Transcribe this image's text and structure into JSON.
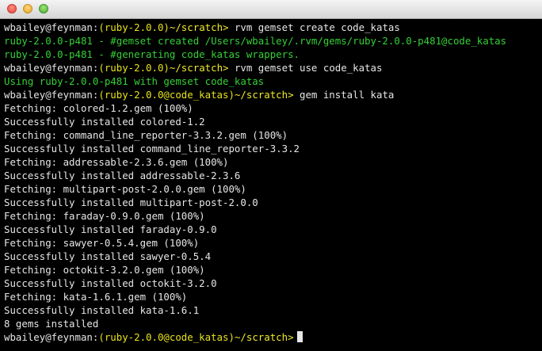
{
  "window": {
    "controls": [
      {
        "name": "close",
        "color": "#e0443a"
      },
      {
        "name": "minimize",
        "color": "#e0a32a"
      },
      {
        "name": "zoom",
        "color": "#4fae32"
      }
    ]
  },
  "colors": {
    "background": "#000000",
    "text": "#e6e6e6",
    "prompt_yellow": "#e8e21a",
    "success_green": "#35d135"
  },
  "terminal": {
    "prompt1": {
      "user": "wbailey@feynman:",
      "gemset": "(ruby-2.0.0)",
      "path": "~/scratch>",
      "command": " rvm gemset create code_katas"
    },
    "out1": "ruby-2.0.0-p481 - #gemset created /Users/wbailey/.rvm/gems/ruby-2.0.0-p481@code_katas",
    "out2": "ruby-2.0.0-p481 - #generating code_katas wrappers.",
    "prompt2": {
      "user": "wbailey@feynman:",
      "gemset": "(ruby-2.0.0)",
      "path": "~/scratch>",
      "command": " rvm gemset use code_katas"
    },
    "out3": "Using ruby-2.0.0-p481 with gemset code_katas",
    "prompt3": {
      "user": "wbailey@feynman:",
      "gemset": "(ruby-2.0.0@code_katas)",
      "path": "~/scratch>",
      "command": " gem install kata"
    },
    "output": [
      "Fetching: colored-1.2.gem (100%)",
      "Successfully installed colored-1.2",
      "Fetching: command_line_reporter-3.3.2.gem (100%)",
      "Successfully installed command_line_reporter-3.3.2",
      "Fetching: addressable-2.3.6.gem (100%)",
      "Successfully installed addressable-2.3.6",
      "Fetching: multipart-post-2.0.0.gem (100%)",
      "Successfully installed multipart-post-2.0.0",
      "Fetching: faraday-0.9.0.gem (100%)",
      "Successfully installed faraday-0.9.0",
      "Fetching: sawyer-0.5.4.gem (100%)",
      "Successfully installed sawyer-0.5.4",
      "Fetching: octokit-3.2.0.gem (100%)",
      "Successfully installed octokit-3.2.0",
      "Fetching: kata-1.6.1.gem (100%)",
      "Successfully installed kata-1.6.1",
      "8 gems installed"
    ],
    "prompt4": {
      "user": "wbailey@feynman:",
      "gemset": "(ruby-2.0.0@code_katas)",
      "path": "~/scratch>",
      "command": ""
    }
  }
}
